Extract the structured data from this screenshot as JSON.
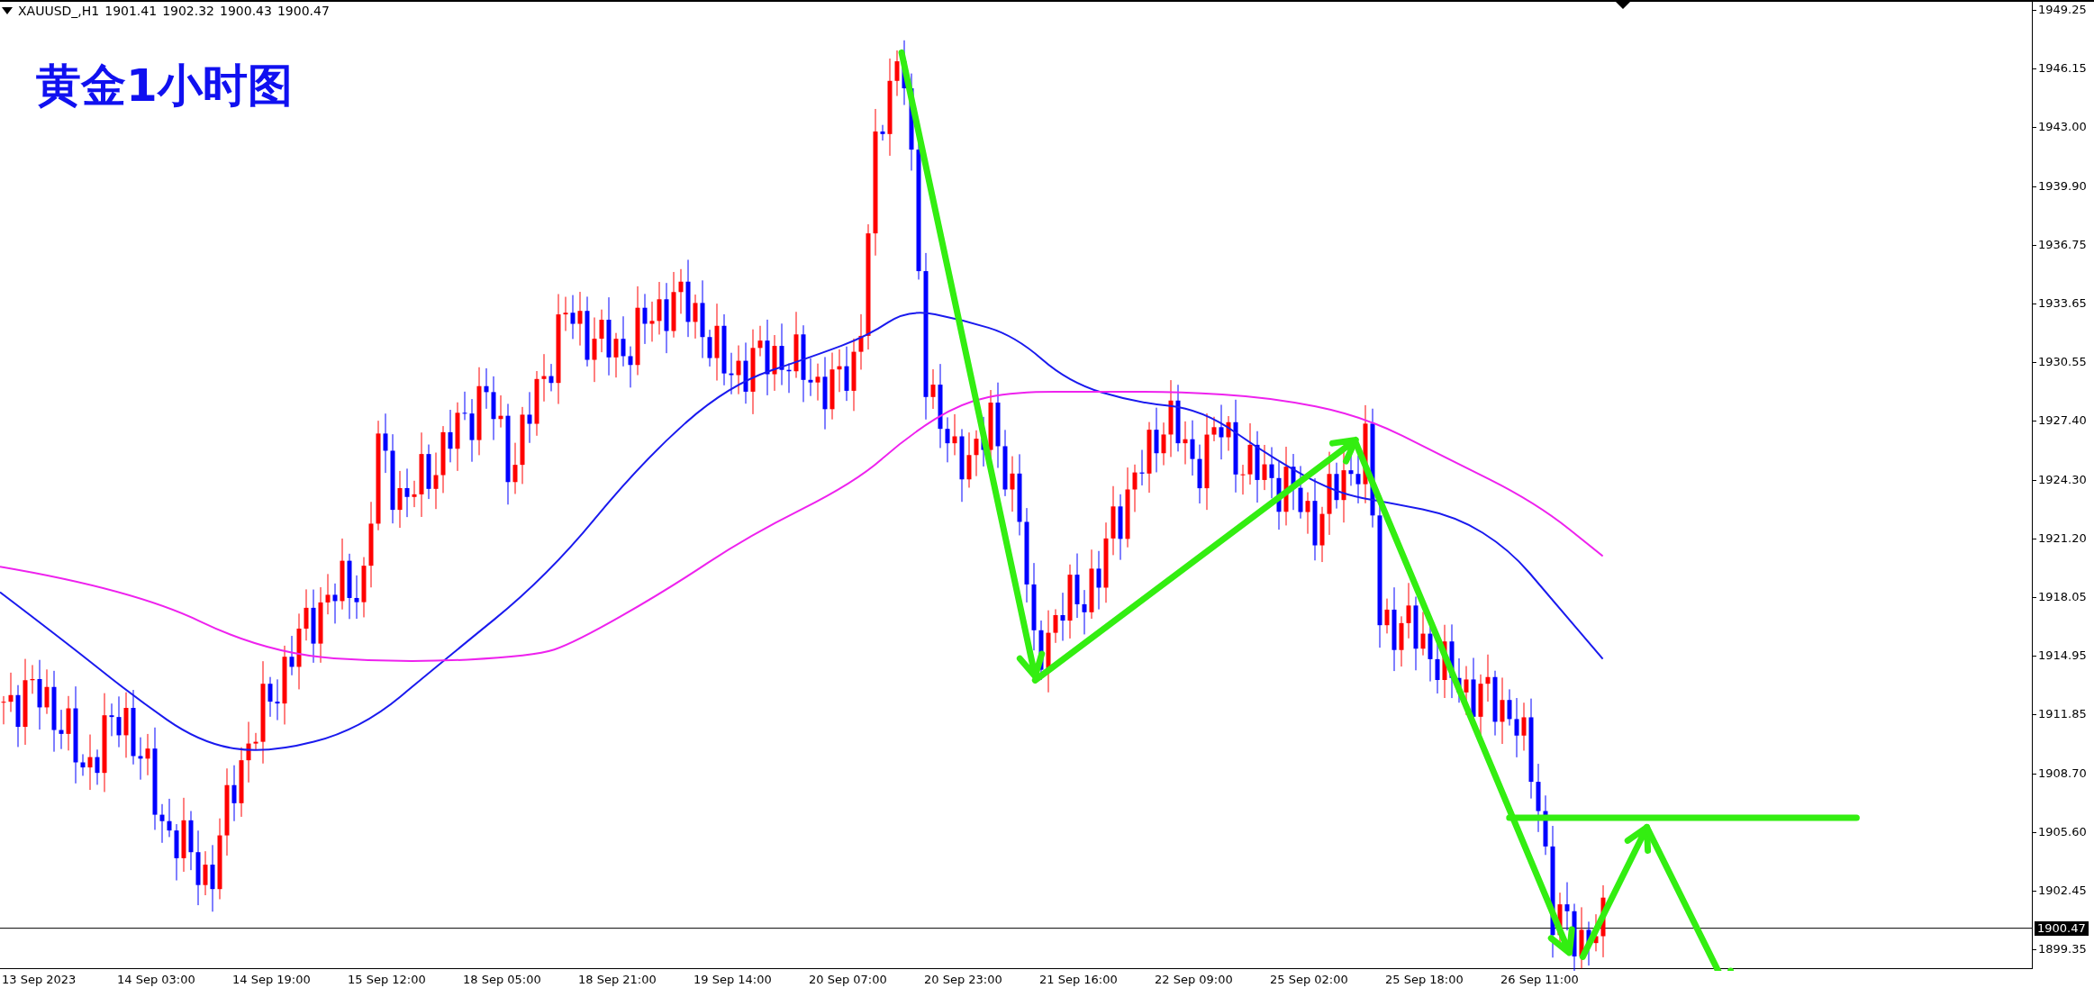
{
  "chart": {
    "symbol": "XAUUSD_,H1",
    "ohlc": [
      "1901.41",
      "1902.32",
      "1900.43",
      "1900.47"
    ],
    "title": "黄金1小时图",
    "price_axis": {
      "ticks": [
        "1949.25",
        "1946.15",
        "1943.00",
        "1939.90",
        "1936.75",
        "1933.65",
        "1930.55",
        "1927.40",
        "1924.30",
        "1921.20",
        "1918.05",
        "1914.95",
        "1911.85",
        "1908.70",
        "1905.60",
        "1902.45",
        "1899.35"
      ],
      "current_price": "1900.47"
    },
    "time_axis": {
      "labels": [
        "13 Sep 2023",
        "14 Sep 03:00",
        "14 Sep 19:00",
        "15 Sep 12:00",
        "18 Sep 05:00",
        "18 Sep 21:00",
        "19 Sep 14:00",
        "20 Sep 07:00",
        "20 Sep 23:00",
        "21 Sep 16:00",
        "22 Sep 09:00",
        "25 Sep 02:00",
        "25 Sep 18:00",
        "26 Sep 11:00"
      ]
    }
  }
}
